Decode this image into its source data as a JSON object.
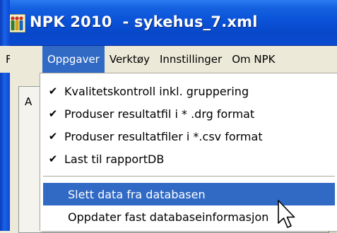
{
  "window": {
    "title": "NPK 2010  - sykehus_7.xml",
    "icon": "npk-app-icon"
  },
  "menubar": {
    "items": [
      {
        "label": "Fil",
        "active": false
      },
      {
        "label": "Oppgaver",
        "active": true
      },
      {
        "label": "Verktøy",
        "active": false
      },
      {
        "label": "Innstillinger",
        "active": false
      },
      {
        "label": "Om NPK",
        "active": false
      }
    ]
  },
  "background": {
    "tab_label": "A"
  },
  "dropdown": {
    "items": [
      {
        "label": "Kvalitetskontroll inkl. gruppering",
        "checked": true
      },
      {
        "label": "Produser resultatfil i  * .drg format",
        "checked": true
      },
      {
        "label": "Produser resultatfiler i *.csv format",
        "checked": true
      },
      {
        "label": "Last til rapportDB",
        "checked": true
      },
      {
        "label": "Slett data fra databasen",
        "checked": false,
        "highlighted": true
      },
      {
        "label": "Oppdater fast databaseinformasjon",
        "checked": false
      }
    ],
    "check_glyph": "✔"
  },
  "colors": {
    "titlebar": "#0A52D8",
    "highlight": "#316AC5",
    "menu_bg": "#ECE9D8"
  }
}
